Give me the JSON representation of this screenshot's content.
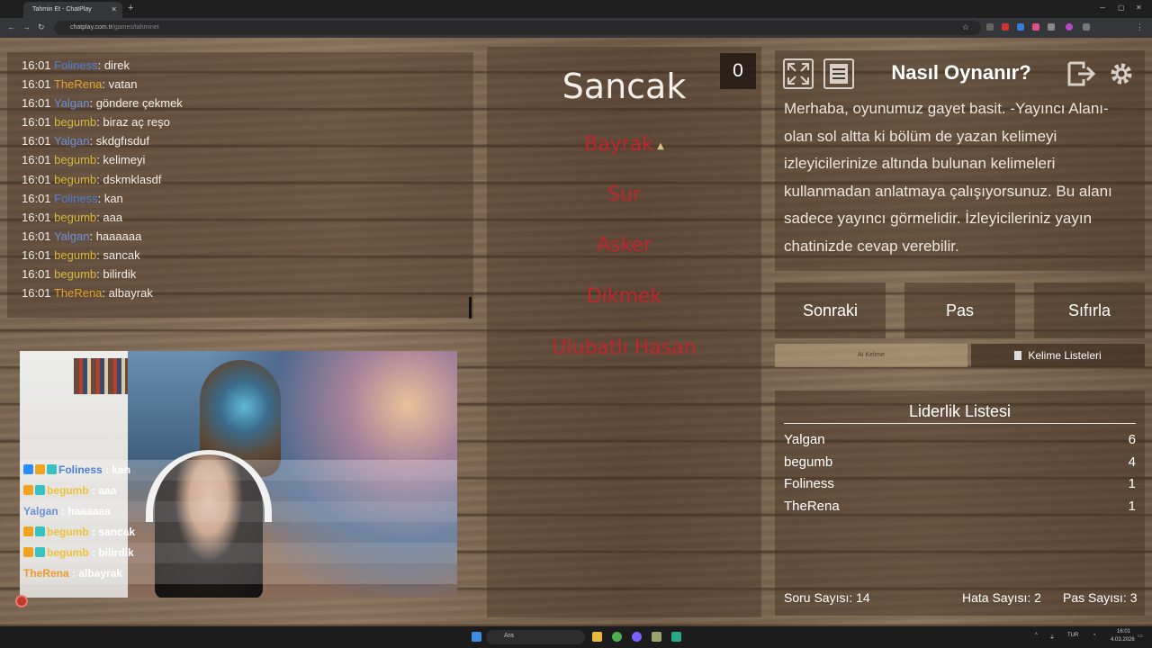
{
  "browser": {
    "tab_title": "Tahmin Et - ChatPlay",
    "url_host": "chatplay.com.tr",
    "url_path": "/games/tahminet"
  },
  "chat_log": [
    {
      "time": "16:01",
      "user": "Foliness",
      "color": "#4e7fd6",
      "msg": "direk"
    },
    {
      "time": "16:01",
      "user": "TheRena",
      "color": "#e3a32b",
      "msg": "vatan"
    },
    {
      "time": "16:01",
      "user": "Yalgan",
      "color": "#6b8fd8",
      "msg": "göndere çekmek"
    },
    {
      "time": "16:01",
      "user": "begumb",
      "color": "#d8b83a",
      "msg": "biraz aç reşo"
    },
    {
      "time": "16:01",
      "user": "Yalgan",
      "color": "#6b8fd8",
      "msg": "skdgfısduf"
    },
    {
      "time": "16:01",
      "user": "begumb",
      "color": "#d8b83a",
      "msg": "kelimeyi"
    },
    {
      "time": "16:01",
      "user": "begumb",
      "color": "#d8b83a",
      "msg": "dskmklasdf"
    },
    {
      "time": "16:01",
      "user": "Foliness",
      "color": "#4e7fd6",
      "msg": "kan"
    },
    {
      "time": "16:01",
      "user": "begumb",
      "color": "#d8b83a",
      "msg": "aaa"
    },
    {
      "time": "16:01",
      "user": "Yalgan",
      "color": "#6b8fd8",
      "msg": "haaaaaa"
    },
    {
      "time": "16:01",
      "user": "begumb",
      "color": "#d8b83a",
      "msg": "sancak"
    },
    {
      "time": "16:01",
      "user": "begumb",
      "color": "#d8b83a",
      "msg": "bilirdik"
    },
    {
      "time": "16:01",
      "user": "TheRena",
      "color": "#e3a32b",
      "msg": "albayrak"
    }
  ],
  "cam_chat": [
    {
      "user": "Foliness",
      "color": "#4e7fd6",
      "msg": ": kan"
    },
    {
      "user": "begumb",
      "color": "#f0c23a",
      "msg": ": aaa"
    },
    {
      "user": "Yalgan",
      "color": "#6b8fd8",
      "msg": ": haaaaaa"
    },
    {
      "user": "begumb",
      "color": "#f0c23a",
      "msg": ": sancak"
    },
    {
      "user": "begumb",
      "color": "#f0c23a",
      "msg": ": bilirdik"
    },
    {
      "user": "TheRena",
      "color": "#f09a2b",
      "msg": ": albayrak"
    }
  ],
  "game": {
    "word": "Sancak",
    "score": "0",
    "taboo_words": [
      "Bayrak",
      "Sur",
      "Asker",
      "Dikmek",
      "Ulubatlı Hasan"
    ],
    "taboo_color": "#c0262d"
  },
  "howto": {
    "title": "Nasıl Oynanır?",
    "text": "Merhaba, oyunumuz gayet basit. -Yayıncı Alanı- olan sol altta ki bölüm de yazan kelimeyi izleyicilerinize altında bulunan kelimeleri kullanmadan anlatmaya çalışıyorsunuz. Bu alanı sadece yayıncı görmelidir. İzleyicileriniz yayın chatinizde cevap verebilir."
  },
  "buttons": {
    "next": "Sonraki",
    "pass": "Pas",
    "reset": "Sıfırla",
    "ai_word": "AI Kelime",
    "word_lists": "Kelime Listeleri"
  },
  "leaderboard": {
    "title": "Liderlik Listesi",
    "rows": [
      {
        "name": "Yalgan",
        "score": "6"
      },
      {
        "name": "begumb",
        "score": "4"
      },
      {
        "name": "Foliness",
        "score": "1"
      },
      {
        "name": "TheRena",
        "score": "1"
      }
    ]
  },
  "stats": {
    "questions": "Soru Sayısı: 14",
    "errors": "Hata Sayısı: 2",
    "passes": "Pas Sayısı: 3"
  },
  "taskbar": {
    "search_placeholder": "Ara",
    "lang": "TUR",
    "time": "16:01",
    "date": "4.03.2026"
  }
}
